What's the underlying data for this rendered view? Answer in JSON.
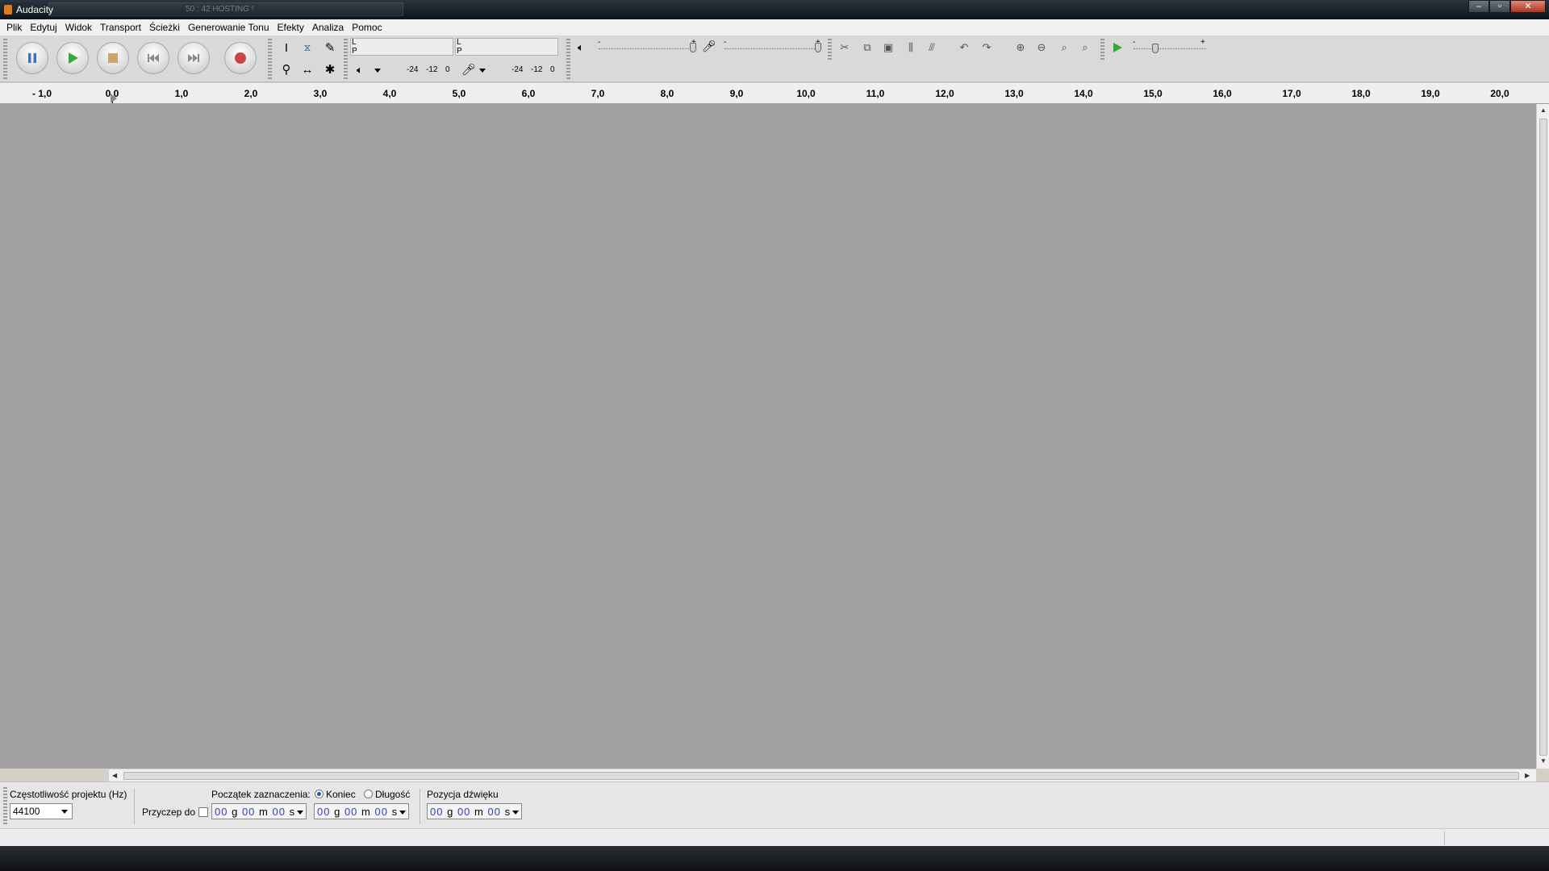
{
  "window": {
    "title": "Audacity",
    "background_text": "50 : 42   HOSTING !",
    "buttons": {
      "minimize": "–",
      "maximize": "▫",
      "close": "✕"
    }
  },
  "menu": {
    "items": [
      "Plik",
      "Edytuj",
      "Widok",
      "Transport",
      "Ścieżki",
      "Generowanie Tonu",
      "Efekty",
      "Analiza",
      "Pomoc"
    ]
  },
  "meters": {
    "playback": {
      "left": "L",
      "right": "P",
      "scale": [
        "-24",
        "-12",
        "0"
      ]
    },
    "record": {
      "left": "L",
      "right": "P",
      "scale": [
        "-24",
        "-12",
        "0"
      ]
    }
  },
  "mixer": {
    "output_min": "-",
    "output_max": "+",
    "input_min": "-",
    "input_max": "+"
  },
  "play_at_speed": {
    "min": "-",
    "max": "+"
  },
  "ruler": {
    "labels": [
      "- 1,0",
      "0,0",
      "1,0",
      "2,0",
      "3,0",
      "4,0",
      "5,0",
      "6,0",
      "7,0",
      "8,0",
      "9,0",
      "10,0",
      "11,0",
      "12,0",
      "13,0",
      "14,0",
      "15,0",
      "16,0",
      "17,0",
      "18,0",
      "19,0",
      "20,0"
    ]
  },
  "selection_bar": {
    "rate_label": "Częstotliwość projektu (Hz)",
    "rate_value": "44100",
    "snap_label": "Przyczep do",
    "start_label": "Początek zaznaczenia:",
    "end_option": "Koniec",
    "length_option": "Długość",
    "position_label": "Pozycja dźwięku",
    "time_format": {
      "h": "00",
      "hu": "g",
      "m": "00",
      "mu": "m",
      "s": "00",
      "su": "s"
    }
  },
  "colors": {
    "track_bg": "#a0a0a0",
    "play": "#37a937",
    "record": "#cc4444",
    "pause": "#3b72c4",
    "stop": "#c9a56a"
  }
}
